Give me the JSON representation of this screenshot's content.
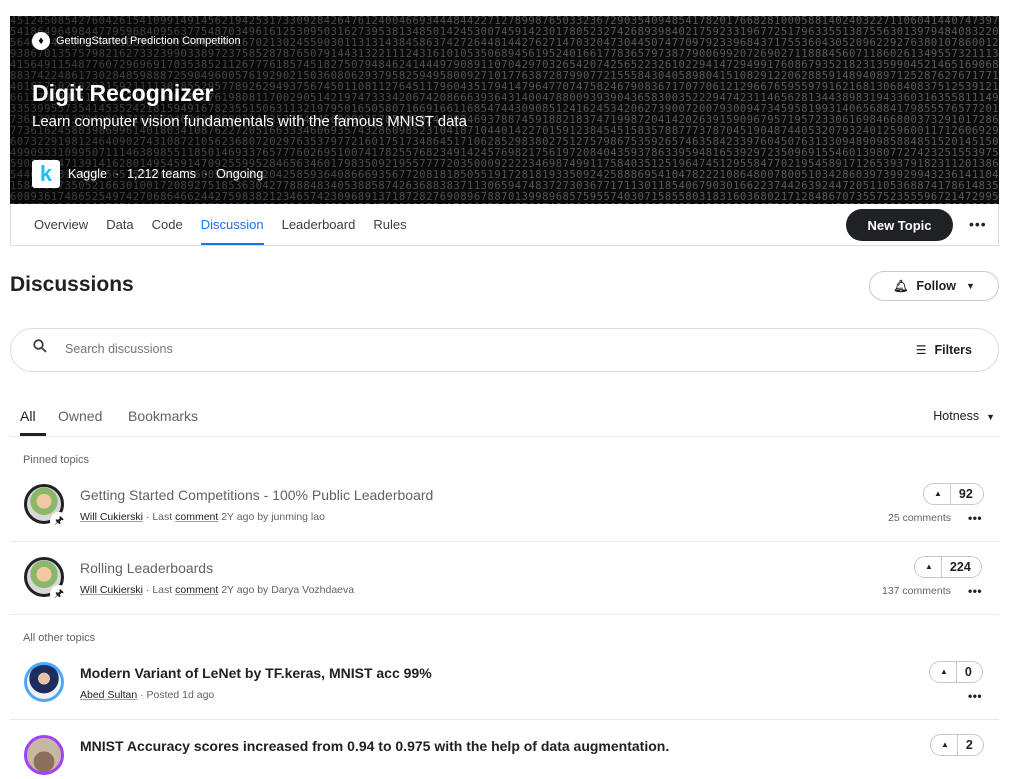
{
  "competition": {
    "type_label": "GettingStarted Prediction Competition",
    "title": "Digit Recognizer",
    "subtitle": "Learn computer vision fundamentals with the famous MNIST data",
    "host": "Kaggle",
    "teams": "1,212 teams",
    "status": "Ongoing",
    "logo_letter": "k"
  },
  "nav": {
    "tabs": [
      "Overview",
      "Data",
      "Code",
      "Discussion",
      "Leaderboard",
      "Rules"
    ],
    "active_tab": "Discussion",
    "new_topic_label": "New Topic",
    "more_label": "•••"
  },
  "discussions": {
    "title": "Discussions",
    "follow_label": "Follow",
    "search_placeholder": "Search discussions",
    "filters_label": "Filters",
    "subtabs": [
      "All",
      "Owned",
      "Bookmarks"
    ],
    "sort_label": "Hotness",
    "pinned_label": "Pinned topics",
    "other_label": "All other topics"
  },
  "pinned_topics": [
    {
      "title": "Getting Started Competitions - 100% Public Leaderboard",
      "author": "Will Cukierski",
      "meta_mid": " · Last ",
      "meta_link": "comment",
      "meta_end": " 2Y ago by junming lao",
      "votes": "92",
      "comments": "25 comments"
    },
    {
      "title": "Rolling Leaderboards",
      "author": "Will Cukierski",
      "meta_mid": " · Last ",
      "meta_link": "comment",
      "meta_end": " 2Y ago by Darya Vozhdaeva",
      "votes": "224",
      "comments": "137 comments"
    }
  ],
  "other_topics": [
    {
      "title": "Modern Variant of LeNet by TF.keras, MNIST acc 99%",
      "author": "Abed Sultan",
      "meta_end": " · Posted 1d ago",
      "votes": "0"
    },
    {
      "title": "MNIST Accuracy scores increased from 0.94 to 0.975 with the help of data augmentation.",
      "votes": "2"
    }
  ],
  "icons": {
    "competition": "trophy-icon",
    "search": "search-icon",
    "filters": "filter-icon",
    "bell": "bell-icon",
    "pin": "pin-icon",
    "upvote": "upvote-icon"
  },
  "colors": {
    "accent": "#1a73e8",
    "dark": "#202124",
    "kaggle_blue": "#20beff"
  }
}
